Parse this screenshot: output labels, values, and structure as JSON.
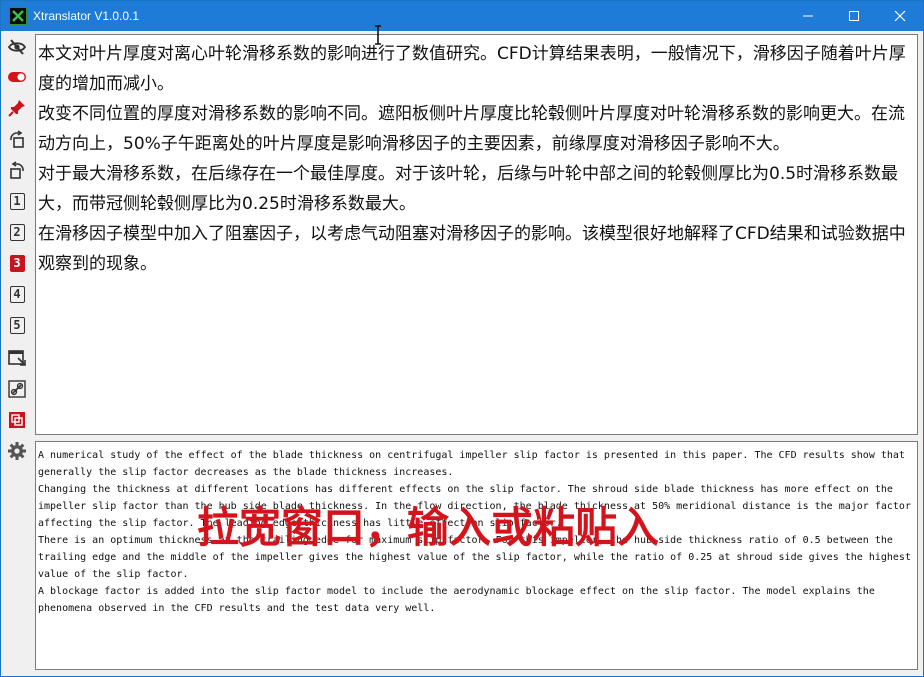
{
  "window": {
    "title": "Xtranslator V1.0.0.1"
  },
  "sidebar": {
    "buttons": [
      {
        "name": "hide-icon"
      },
      {
        "name": "toggle-icon"
      },
      {
        "name": "pin-icon"
      },
      {
        "name": "rotate-left-icon"
      },
      {
        "name": "rotate-right-icon"
      },
      {
        "label": "1"
      },
      {
        "label": "2"
      },
      {
        "label": "3",
        "active": true
      },
      {
        "label": "4"
      },
      {
        "label": "5"
      },
      {
        "name": "window-icon"
      },
      {
        "name": "link-icon"
      },
      {
        "name": "copy-icon"
      },
      {
        "name": "gear-icon"
      }
    ]
  },
  "source": {
    "text": "本文对叶片厚度对离心叶轮滑移系数的影响进行了数值研究。CFD计算结果表明，一般情况下，滑移因子随着叶片厚度的增加而减小。\n改变不同位置的厚度对滑移系数的影响不同。遮阳板侧叶片厚度比轮毂侧叶片厚度对叶轮滑移系数的影响更大。在流动方向上，50%子午距离处的叶片厚度是影响滑移因子的主要因素，前缘厚度对滑移因子影响不大。\n对于最大滑移系数，在后缘存在一个最佳厚度。对于该叶轮，后缘与叶轮中部之间的轮毂侧厚比为0.5时滑移系数最大，而带冠侧轮毂侧厚比为0.25时滑移系数最大。\n在滑移因子模型中加入了阻塞因子，以考虑气动阻塞对滑移因子的影响。该模型很好地解释了CFD结果和试验数据中观察到的现象。"
  },
  "translation": {
    "text": "A numerical study of the effect of the blade thickness on centrifugal impeller slip factor is presented in this paper. The CFD results show that generally the slip factor decreases as the blade thickness increases.\nChanging the thickness at different locations has different effects on the slip factor. The shroud side blade thickness has more effect on the impeller slip factor than the hub side blade thickness. In the flow direction, the blade thickness at 50% meridional distance is the major factor affecting the slip factor. The leading edge thickness has little effect on slip factor.\nThere is an optimum thickness at the trailing edge for maximum slip factor. For this impeller, the hub side thickness ratio of 0.5 between the trailing edge and the middle of the impeller gives the highest value of the slip factor, while the ratio of 0.25 at shroud side gives the highest value of the slip factor.\nA blockage factor is added into the slip factor model to include the aerodynamic blockage effect on the slip factor. The model explains the phenomena observed in the CFD results and the test data very well."
  },
  "overlay": {
    "hint": "拉宽窗口，输入或粘贴入"
  },
  "colors": {
    "titlebar": "#1e7cd8",
    "active_number": "#c8141e",
    "hint": "#d4141c"
  }
}
